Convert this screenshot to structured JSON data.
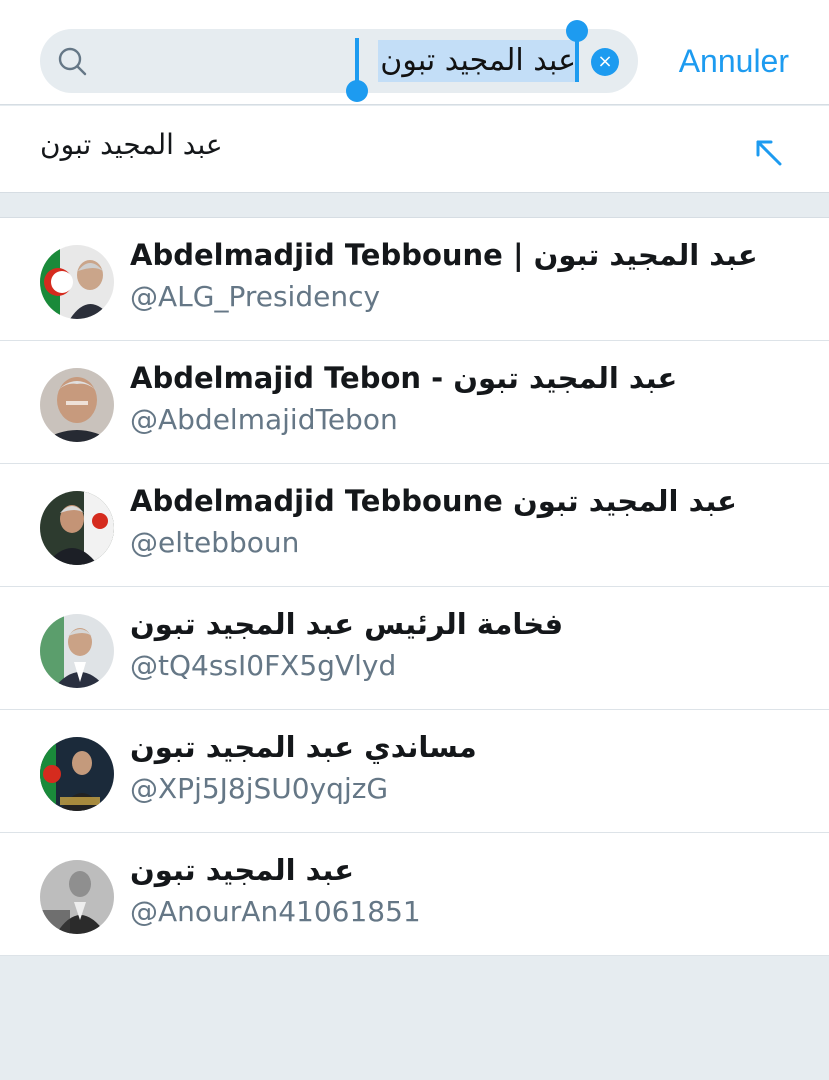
{
  "search": {
    "query": "عبد المجيد تبون",
    "cancel_label": "Annuler",
    "clear_icon": "×",
    "icon": "search-icon"
  },
  "suggestion": {
    "text": "عبد المجيد تبون",
    "icon": "fill-arrow-icon"
  },
  "results": [
    {
      "name": "Abdelmadjid Tebboune | عبد المجيد تبون",
      "handle": "@ALG_Presidency"
    },
    {
      "name": "Abdelmajid Tebon - عبد المجيد تبون",
      "handle": "@AbdelmajidTebon"
    },
    {
      "name": "Abdelmadjid Tebboune عبد المجيد تبون",
      "handle": "@eltebboun"
    },
    {
      "name": "فخامة الرئيس عبد المجيد تبون",
      "handle": "@tQ4ssI0FX5gVlyd"
    },
    {
      "name": "مساندي عبد المجيد تبون",
      "handle": "@XPj5J8jSU0yqjzG"
    },
    {
      "name": "عبد المجيد تبون",
      "handle": "@AnourAn41061851"
    }
  ],
  "colors": {
    "accent": "#1d9bf0",
    "background": "#e6ecf0",
    "secondary_text": "#657786"
  }
}
